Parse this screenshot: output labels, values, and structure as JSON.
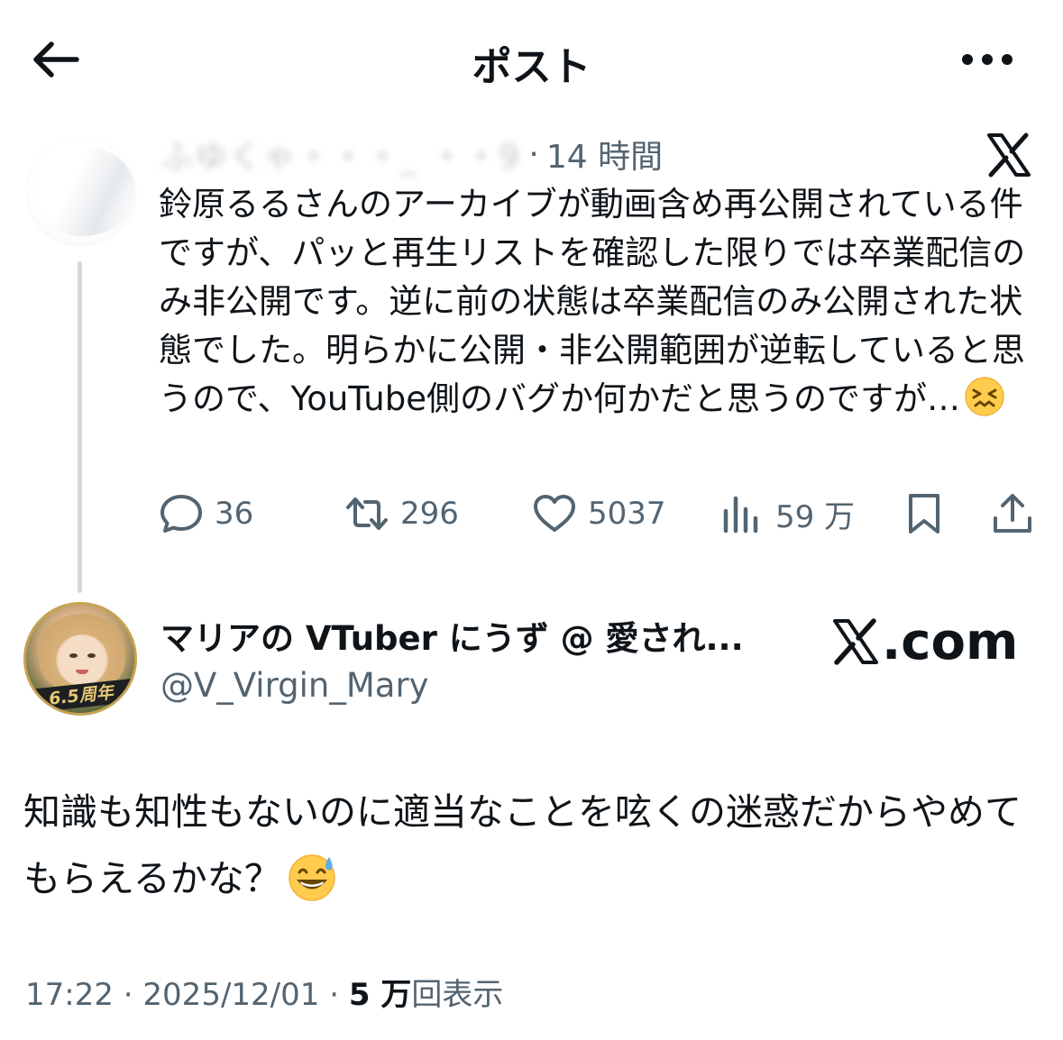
{
  "header": {
    "title": "ポスト"
  },
  "parent_post": {
    "author_name_blurred": "ふゆくゃ・・・_ ・・9",
    "separator": "·",
    "time_ago": "14 時間",
    "text": "鈴原るるさんのアーカイブが動画含め再公開されている件ですが、パッと再生リストを確認した限りでは卒業配信のみ非公開です。逆に前の状態は卒業配信のみ公開された状態でした。明らかに公開・非公開範囲が逆転していると思うので、YouTube側のバグか何かだと思うのですが…",
    "emoji": "confounded-face",
    "actions": {
      "replies": "36",
      "reposts": "296",
      "likes": "5037",
      "views": "59 万"
    }
  },
  "main_post": {
    "author_name": "マリアの VTuber にうず @ 愛され...",
    "author_handle": "@V_Virgin_Mary",
    "avatar_badge": "6.5周年",
    "source_badge": ".com",
    "text": "知識も知性もないのに適当なことを呟くの迷惑だからやめてもらえるかな？",
    "emoji": "grinning-face-with-sweat",
    "time": "17:22",
    "date": "2025/12/01",
    "separator": "·",
    "views_count": "5 万",
    "views_label": "回表示"
  },
  "colors": {
    "text_primary": "#0f1419",
    "text_secondary": "#536471",
    "thread_line": "#cfd9de"
  }
}
